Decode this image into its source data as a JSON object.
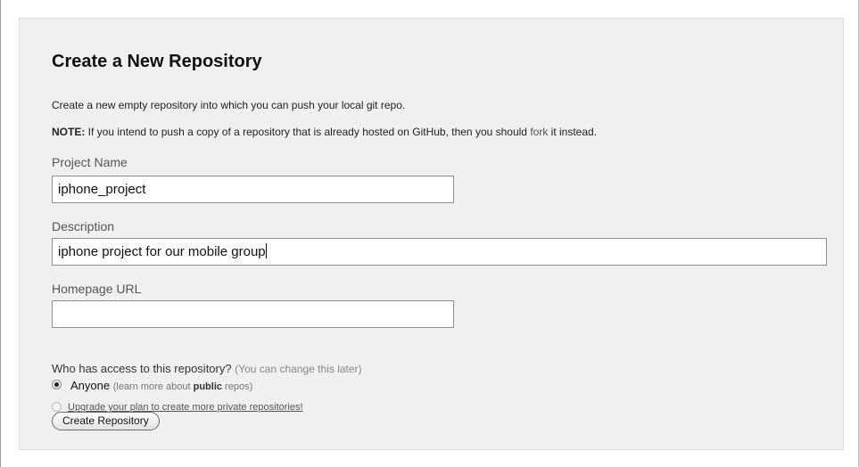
{
  "heading": "Create a New Repository",
  "intro": "Create a new empty repository into which you can push your local git repo.",
  "note": {
    "label": "NOTE:",
    "text_before": " If you intend to push a copy of a repository that is already hosted on GitHub, then you should ",
    "link": "fork",
    "text_after": " it instead."
  },
  "fields": {
    "project_name": {
      "label": "Project Name",
      "value": "iphone_project"
    },
    "description": {
      "label": "Description",
      "value": "iphone project for our mobile group"
    },
    "homepage": {
      "label": "Homepage URL",
      "value": ""
    }
  },
  "access": {
    "question": "Who has access to this repository?",
    "hint": "(You can change this later)",
    "options": [
      {
        "label": "Anyone",
        "hint_before": "(learn more about ",
        "hint_bold": "public",
        "hint_after": " repos)",
        "selected": true
      },
      {
        "label": "Upgrade your plan to create more private repositories!",
        "selected": false,
        "disabled": true
      }
    ]
  },
  "submit_label": "Create Repository"
}
